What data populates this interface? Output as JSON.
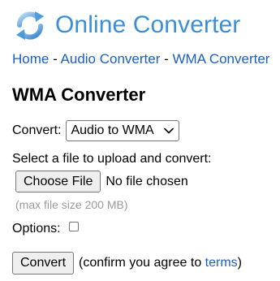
{
  "header": {
    "site_title": "Online Converter"
  },
  "breadcrumb": {
    "home": "Home",
    "sep1": " - ",
    "audio_converter": "Audio Converter",
    "sep2": " - ",
    "current": "WMA Converter"
  },
  "page": {
    "title": "WMA Converter"
  },
  "convert": {
    "label": "Convert:",
    "selected_option": "Audio to WMA"
  },
  "upload": {
    "label": "Select a file to upload and convert:",
    "choose_file_label": "Choose File",
    "file_status": "No file chosen",
    "max_size_note": "(max file size 200 MB)"
  },
  "options": {
    "label": "Options:",
    "checked": false
  },
  "submit": {
    "button_label": "Convert",
    "confirm_prefix": "(confirm you agree to ",
    "terms_link": "terms",
    "confirm_suffix": ")"
  },
  "colors": {
    "brand_blue": "#3a8fd6",
    "link_blue": "#1a5fc4",
    "muted_gray": "#9a9a9a"
  },
  "icons": {
    "logo": "refresh-arrows-icon",
    "select": "chevron-down-icon"
  }
}
